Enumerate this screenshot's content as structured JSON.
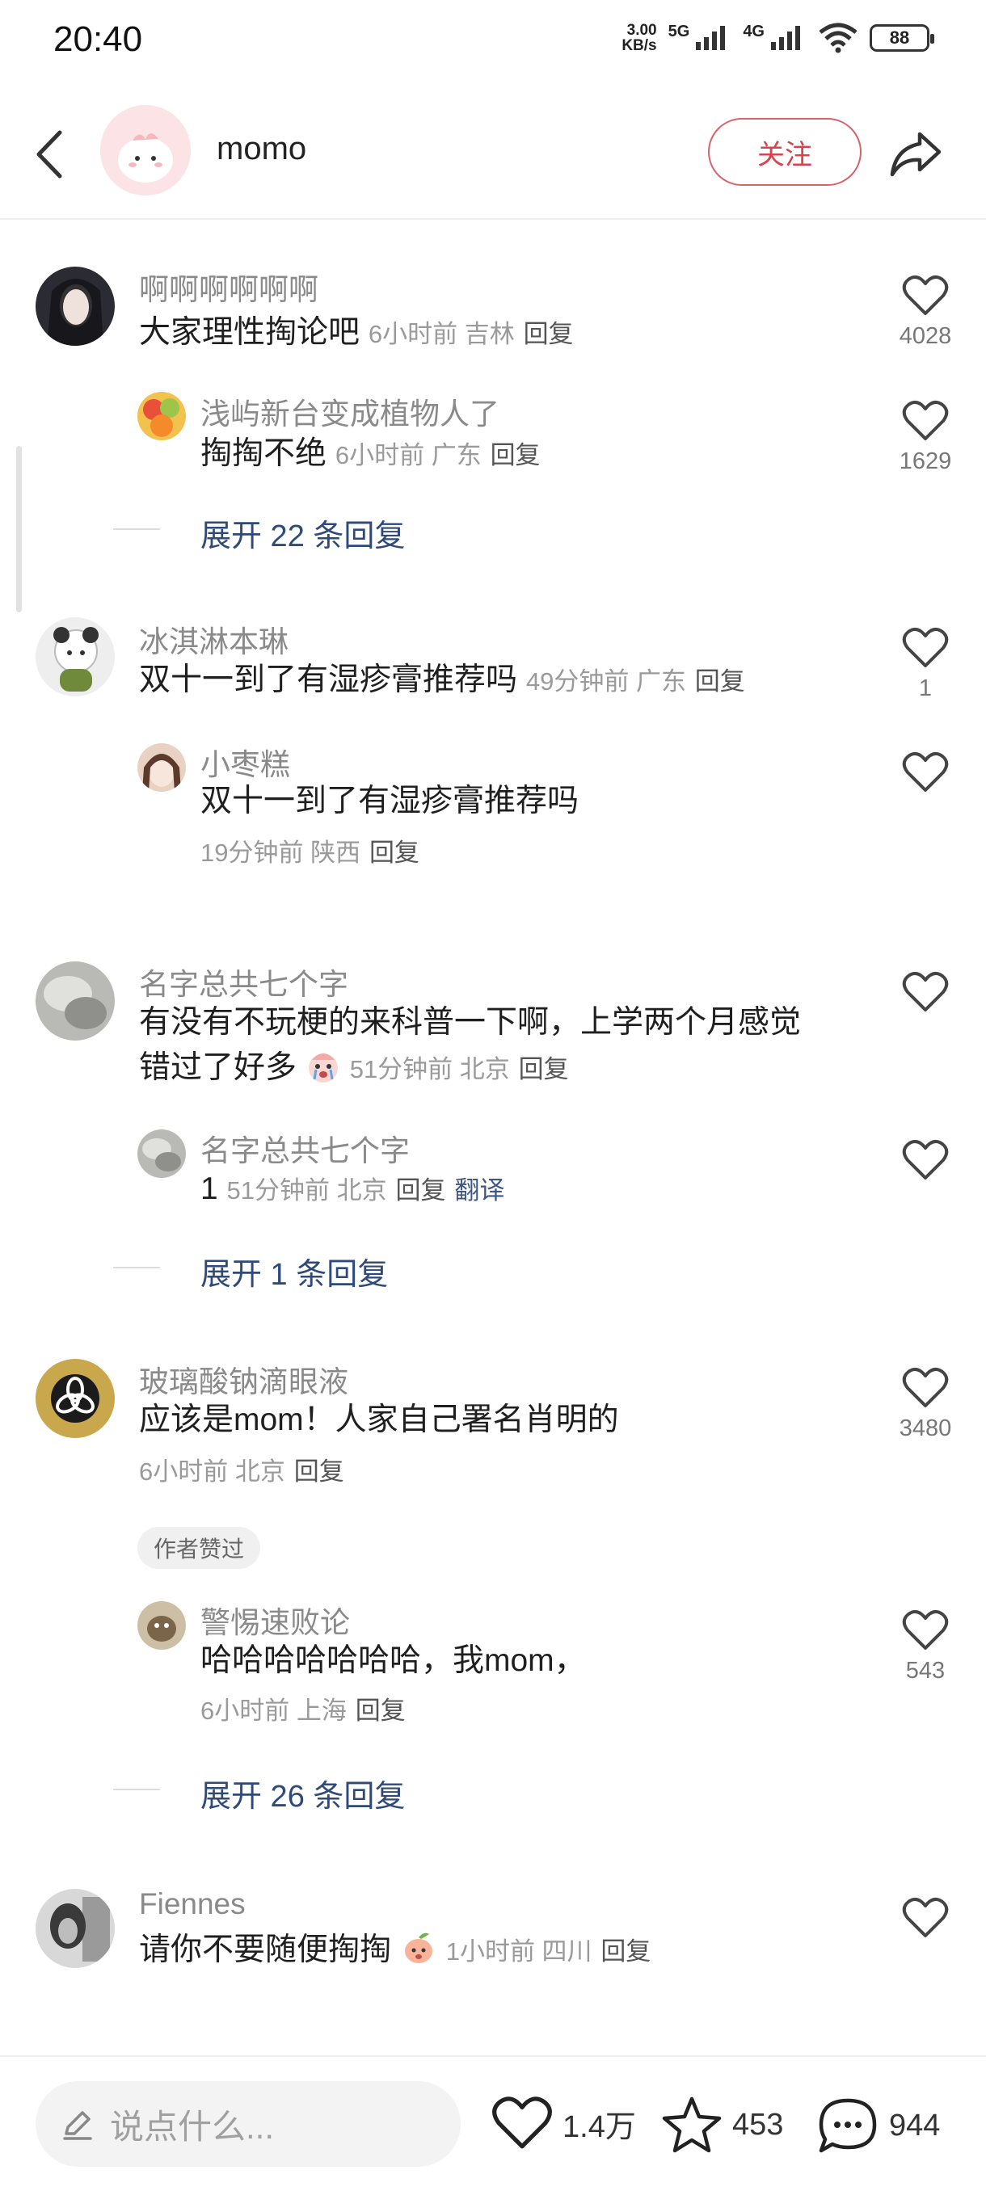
{
  "status_bar": {
    "time": "20:40",
    "speed_value": "3.00",
    "speed_unit": "KB/s",
    "net1": "5G",
    "net2": "4G",
    "battery": "88"
  },
  "header": {
    "username": "momo",
    "follow_label": "关注"
  },
  "comments": [
    {
      "user": "啊啊啊啊啊啊",
      "text": "大家理性掏论吧",
      "meta": "6小时前 吉林",
      "reply_label": "回复",
      "likes": "4028",
      "replies": [
        {
          "user": "浅屿新台变成植物人了",
          "text": "掏掏不绝",
          "meta": "6小时前 广东",
          "reply_label": "回复",
          "likes": "1629"
        }
      ],
      "expand_label": "展开 22 条回复"
    },
    {
      "user": "冰淇淋本琳",
      "text": "双十一到了有湿疹膏推荐吗",
      "meta": "49分钟前 广东",
      "reply_label": "回复",
      "likes": "1",
      "replies": [
        {
          "user": "小枣糕",
          "text": "双十一到了有湿疹膏推荐吗",
          "meta": "19分钟前 陕西",
          "reply_label": "回复"
        }
      ]
    },
    {
      "user": "名字总共七个字",
      "text_line1": "有没有不玩梗的来科普一下啊，上学两个月感觉",
      "text_line2": "错过了好多",
      "meta": "51分钟前 北京",
      "reply_label": "回复",
      "replies": [
        {
          "user": "名字总共七个字",
          "text": "1",
          "meta": "51分钟前 北京",
          "reply_label": "回复",
          "translate_label": "翻译"
        }
      ],
      "expand_label": "展开 1 条回复"
    },
    {
      "user": "玻璃酸钠滴眼液",
      "text": "应该是mom！人家自己署名肖明的",
      "meta": "6小时前 北京",
      "reply_label": "回复",
      "likes": "3480",
      "author_badge": "作者赞过",
      "replies": [
        {
          "user": "警惕速败论",
          "text": "哈哈哈哈哈哈哈，我mom，",
          "meta": "6小时前 上海",
          "reply_label": "回复",
          "likes": "543"
        }
      ],
      "expand_label": "展开 26 条回复"
    },
    {
      "user": "Fiennes",
      "text": "请你不要随便掏掏",
      "meta": "1小时前 四川",
      "reply_label": "回复"
    }
  ],
  "bottom_bar": {
    "input_placeholder": "说点什么...",
    "likes": "1.4万",
    "stars": "453",
    "comments": "944"
  },
  "colors": {
    "accent_red": "#d9414b",
    "link_blue": "#2e4a7a"
  }
}
